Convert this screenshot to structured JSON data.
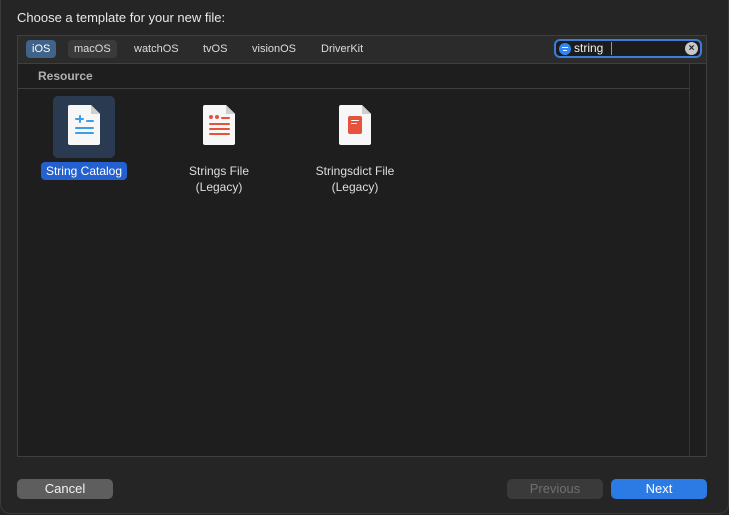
{
  "dialog": {
    "title": "Choose a template for your new file:"
  },
  "platforms": [
    {
      "label": "iOS",
      "selected": true
    },
    {
      "label": "macOS",
      "selected": false
    },
    {
      "label": "watchOS",
      "selected": false
    },
    {
      "label": "tvOS",
      "selected": false
    },
    {
      "label": "visionOS",
      "selected": false
    },
    {
      "label": "DriverKit",
      "selected": false
    }
  ],
  "search": {
    "value": "string",
    "placeholder": "Filter",
    "icon": "filter-icon",
    "clear_icon": "clear-icon"
  },
  "section": {
    "title": "Resource"
  },
  "templates": [
    {
      "label": "String Catalog",
      "icon": "string-catalog-icon",
      "selected": true,
      "accent": "#3b9ee8"
    },
    {
      "label": "Strings File\n(Legacy)",
      "icon": "strings-file-icon",
      "selected": false,
      "accent": "#e5533d"
    },
    {
      "label": "Stringsdict File\n(Legacy)",
      "icon": "stringsdict-file-icon",
      "selected": false,
      "accent": "#e5533d"
    }
  ],
  "buttons": {
    "cancel": "Cancel",
    "previous": "Previous",
    "next": "Next"
  },
  "colors": {
    "accent": "#2c7be5",
    "selection": "#2360d0",
    "background": "#252525"
  }
}
